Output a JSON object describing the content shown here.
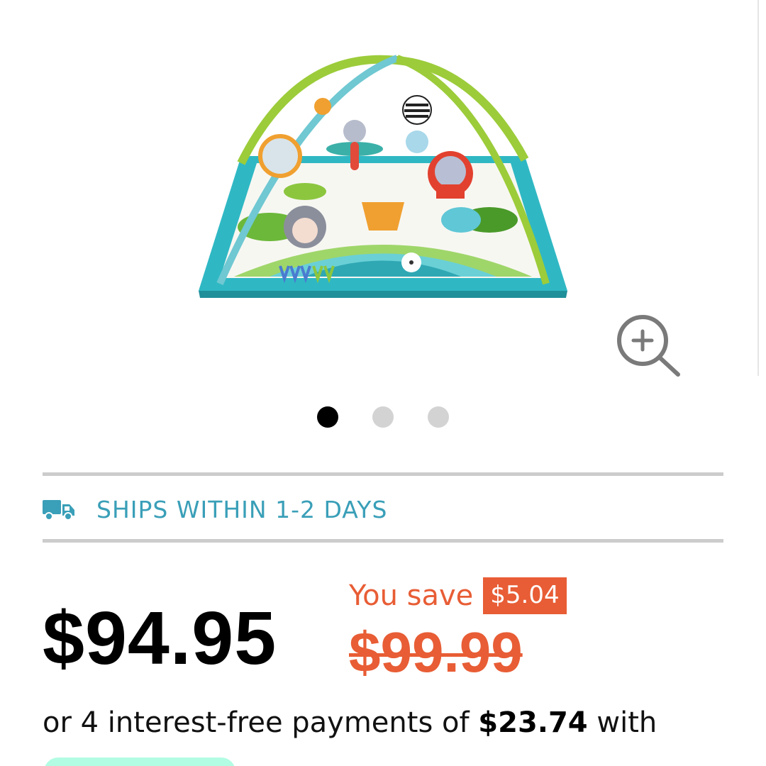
{
  "gallery": {
    "image_icon": "baby-play-gym-image",
    "zoom_icon": "zoom-in-icon",
    "dots": [
      {
        "active": true
      },
      {
        "active": false
      },
      {
        "active": false
      }
    ]
  },
  "shipping": {
    "icon": "truck-icon",
    "text": "SHIPS WITHIN 1-2 DAYS",
    "color": "#3a9fb8"
  },
  "pricing": {
    "price": "$94.95",
    "you_save_label": "You save",
    "savings": "$5.04",
    "original_price": "$99.99",
    "accent_color": "#e85d35"
  },
  "installments": {
    "prefix": "or 4 interest-free payments of",
    "amount": "$23.74",
    "suffix": "with"
  },
  "payment_provider": {
    "badge_color": "#b2fce4"
  }
}
